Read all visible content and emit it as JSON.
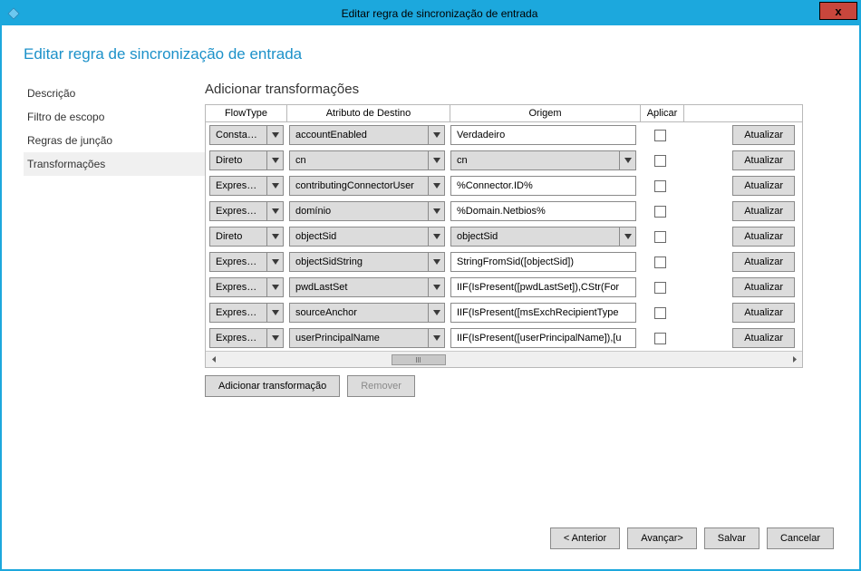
{
  "window": {
    "title": "Editar regra de sincronização de entrada"
  },
  "page": {
    "title": "Editar regra de sincronização de entrada"
  },
  "sidebar": {
    "items": [
      {
        "label": "Descrição"
      },
      {
        "label": "Filtro de escopo"
      },
      {
        "label": "Regras de junção"
      },
      {
        "label": "Transformações"
      }
    ],
    "active_index": 3
  },
  "section": {
    "title": "Adicionar transformações"
  },
  "columns": {
    "flowtype": "FlowType",
    "attribute": "Atributo de Destino",
    "origin": "Origem",
    "apply": "Aplicar",
    "action": ""
  },
  "updateLabel": "Atualizar",
  "rows": [
    {
      "flow": "Constante",
      "attr": "accountEnabled",
      "originType": "text",
      "origin": "Verdadeiro",
      "apply": false
    },
    {
      "flow": "Direto",
      "attr": "cn",
      "originType": "dd",
      "origin": "cn",
      "apply": false
    },
    {
      "flow": "Expressão",
      "attr": "contributingConnectorUser",
      "originType": "text",
      "origin": "%Connector.ID%",
      "apply": false
    },
    {
      "flow": "Expressão",
      "attr": "domínio",
      "originType": "text",
      "origin": "%Domain.Netbios%",
      "apply": false
    },
    {
      "flow": "Direto",
      "attr": "objectSid",
      "originType": "dd",
      "origin": "objectSid",
      "apply": false
    },
    {
      "flow": "Expressão",
      "attr": "objectSidString",
      "originType": "text",
      "origin": "StringFromSid([objectSid])",
      "apply": false
    },
    {
      "flow": "Expressão",
      "attr": "pwdLastSet",
      "originType": "text",
      "origin": "IIF(IsPresent([pwdLastSet]),CStr(For",
      "apply": false
    },
    {
      "flow": "Expressão",
      "attr": "sourceAnchor",
      "originType": "text",
      "origin": "IIF(IsPresent([msExchRecipientType",
      "apply": false
    },
    {
      "flow": "Expressão",
      "attr": "userPrincipalName",
      "originType": "text",
      "origin": "IIF(IsPresent([userPrincipalName]),[u",
      "apply": false
    }
  ],
  "belowButtons": {
    "add": "Adicionar transformação",
    "remove": "Remover"
  },
  "footer": {
    "prev": "< Anterior",
    "next": "Avançar>",
    "save": "Salvar",
    "cancel": "Cancelar"
  }
}
